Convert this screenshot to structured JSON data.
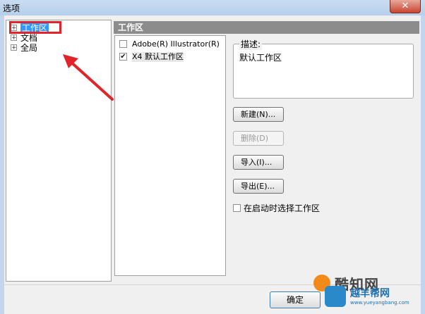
{
  "window": {
    "title": "选项",
    "close_glyph": "✕"
  },
  "tree": {
    "items": [
      {
        "label": "工作区",
        "expander": "+",
        "selected": true
      },
      {
        "label": "文档",
        "expander": "+",
        "selected": false
      },
      {
        "label": "全局",
        "expander": "+",
        "selected": false
      }
    ]
  },
  "section": {
    "title": "工作区"
  },
  "workspaces": {
    "items": [
      {
        "label": "Adobe(R) Illustrator(R)",
        "checked": false,
        "check_glyph": ""
      },
      {
        "label": "X4 默认工作区",
        "checked": true,
        "check_glyph": "✔"
      }
    ]
  },
  "description": {
    "label": "描述:",
    "text": "默认工作区"
  },
  "buttons": {
    "new": "新建(N)...",
    "delete": "删除(D)",
    "import": "导入(I)...",
    "export": "导出(E)..."
  },
  "startup": {
    "label": "在启动时选择工作区",
    "checked": false
  },
  "footer": {
    "ok": "确定"
  },
  "watermarks": {
    "kuzhi": "酷知网",
    "yueyang": "越羊帮网",
    "yueyang_url": "www.yueyangbang.com"
  },
  "colors": {
    "selection": "#3399ff",
    "annotation_red": "#e0242a",
    "header_gray": "#8c8c8c"
  },
  "icons": [
    "close-icon",
    "expand-icon",
    "checkbox-icon",
    "arrow-annotation-icon"
  ]
}
